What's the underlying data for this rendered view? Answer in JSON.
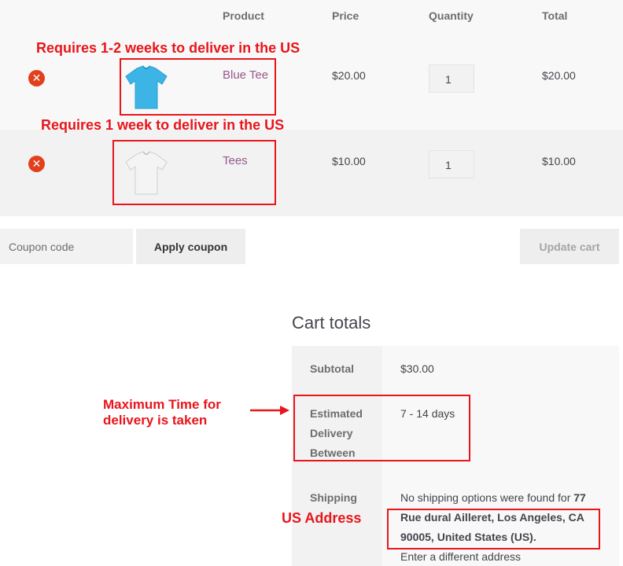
{
  "headers": {
    "product": "Product",
    "price": "Price",
    "quantity": "Quantity",
    "total": "Total"
  },
  "items": [
    {
      "name": "Blue Tee",
      "price": "$20.00",
      "quantity": "1",
      "total": "$20.00",
      "image": "blue-tshirt",
      "color": "#3cb4e6",
      "annotation": "Requires 1-2 weeks to deliver in the US"
    },
    {
      "name": "Tees",
      "price": "$10.00",
      "quantity": "1",
      "total": "$10.00",
      "image": "white-tshirt",
      "color": "#f4f4f4",
      "annotation": "Requires 1 week to deliver in the US"
    }
  ],
  "actions": {
    "coupon_placeholder": "Coupon code",
    "apply_coupon": "Apply coupon",
    "update_cart": "Update cart"
  },
  "totals": {
    "title": "Cart totals",
    "subtotal_label": "Subtotal",
    "subtotal_value": "$30.00",
    "delivery_label_1": "Estimated",
    "delivery_label_2": "Delivery",
    "delivery_label_3": "Between",
    "delivery_value": "7 - 14 days",
    "shipping_label": "Shipping",
    "shipping_text": "No shipping options were found for",
    "shipping_addr_1": "77",
    "shipping_addr_2": "Rue dural Ailleret, Los Angeles, CA",
    "shipping_addr_3": "90005, United States (US).",
    "shipping_link": "Enter a different address"
  },
  "annotations": {
    "max_time_1": "Maximum Time for",
    "max_time_2": "delivery is taken",
    "us_address": "US Address"
  },
  "colors": {
    "accent_link": "#96588a",
    "remove_icon": "#e2401c",
    "annotation_red": "#e8151b"
  }
}
